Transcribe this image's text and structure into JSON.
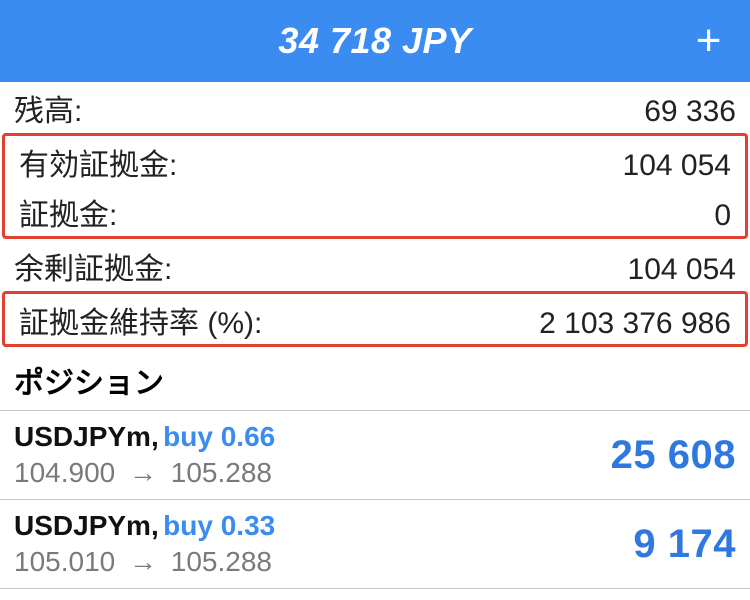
{
  "header": {
    "total": "34 718 JPY",
    "add_label": "+"
  },
  "summary": {
    "balance": {
      "label": "残高:",
      "value": "69 336"
    },
    "equity": {
      "label": "有効証拠金:",
      "value": "104 054"
    },
    "margin": {
      "label": "証拠金:",
      "value": "0"
    },
    "free_margin": {
      "label": "余剰証拠金:",
      "value": "104 054"
    },
    "margin_level": {
      "label": "証拠金維持率 (%):",
      "value": "2 103 376 986"
    }
  },
  "positions_title": "ポジション",
  "positions": [
    {
      "symbol": "USDJPYm",
      "action": "buy 0.66",
      "open_price": "104.900",
      "current_price": "105.288",
      "pl": "25 608"
    },
    {
      "symbol": "USDJPYm",
      "action": "buy 0.33",
      "open_price": "105.010",
      "current_price": "105.288",
      "pl": "9 174"
    }
  ],
  "glyphs": {
    "arrow": "→",
    "comma": ","
  }
}
